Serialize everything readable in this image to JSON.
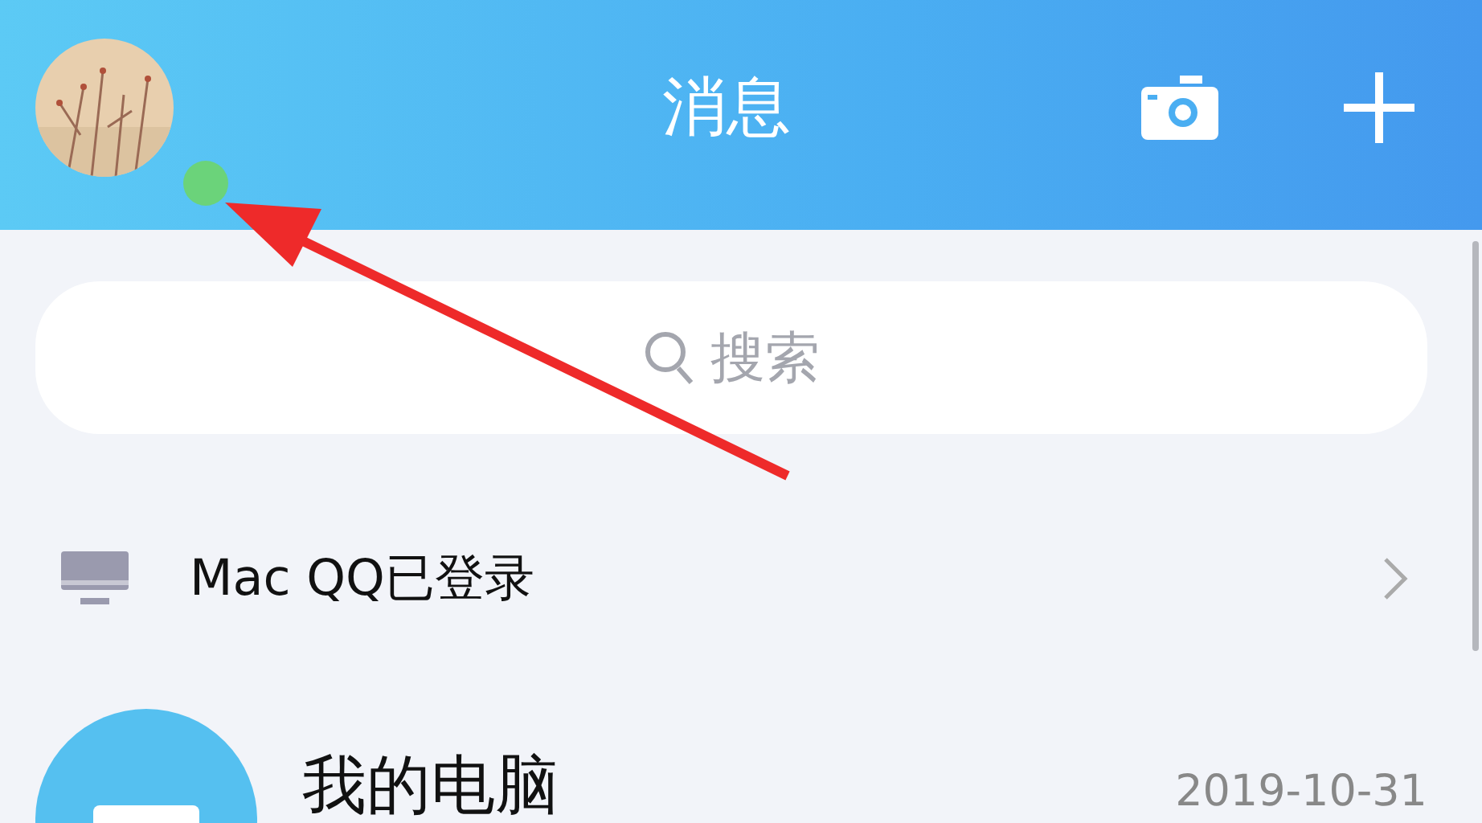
{
  "header": {
    "title": "消息",
    "online": true
  },
  "search": {
    "placeholder": "搜索"
  },
  "device_row": {
    "label": "Mac QQ已登录"
  },
  "conversations": [
    {
      "name": "我的电脑",
      "time": "2019-10-31"
    }
  ]
}
